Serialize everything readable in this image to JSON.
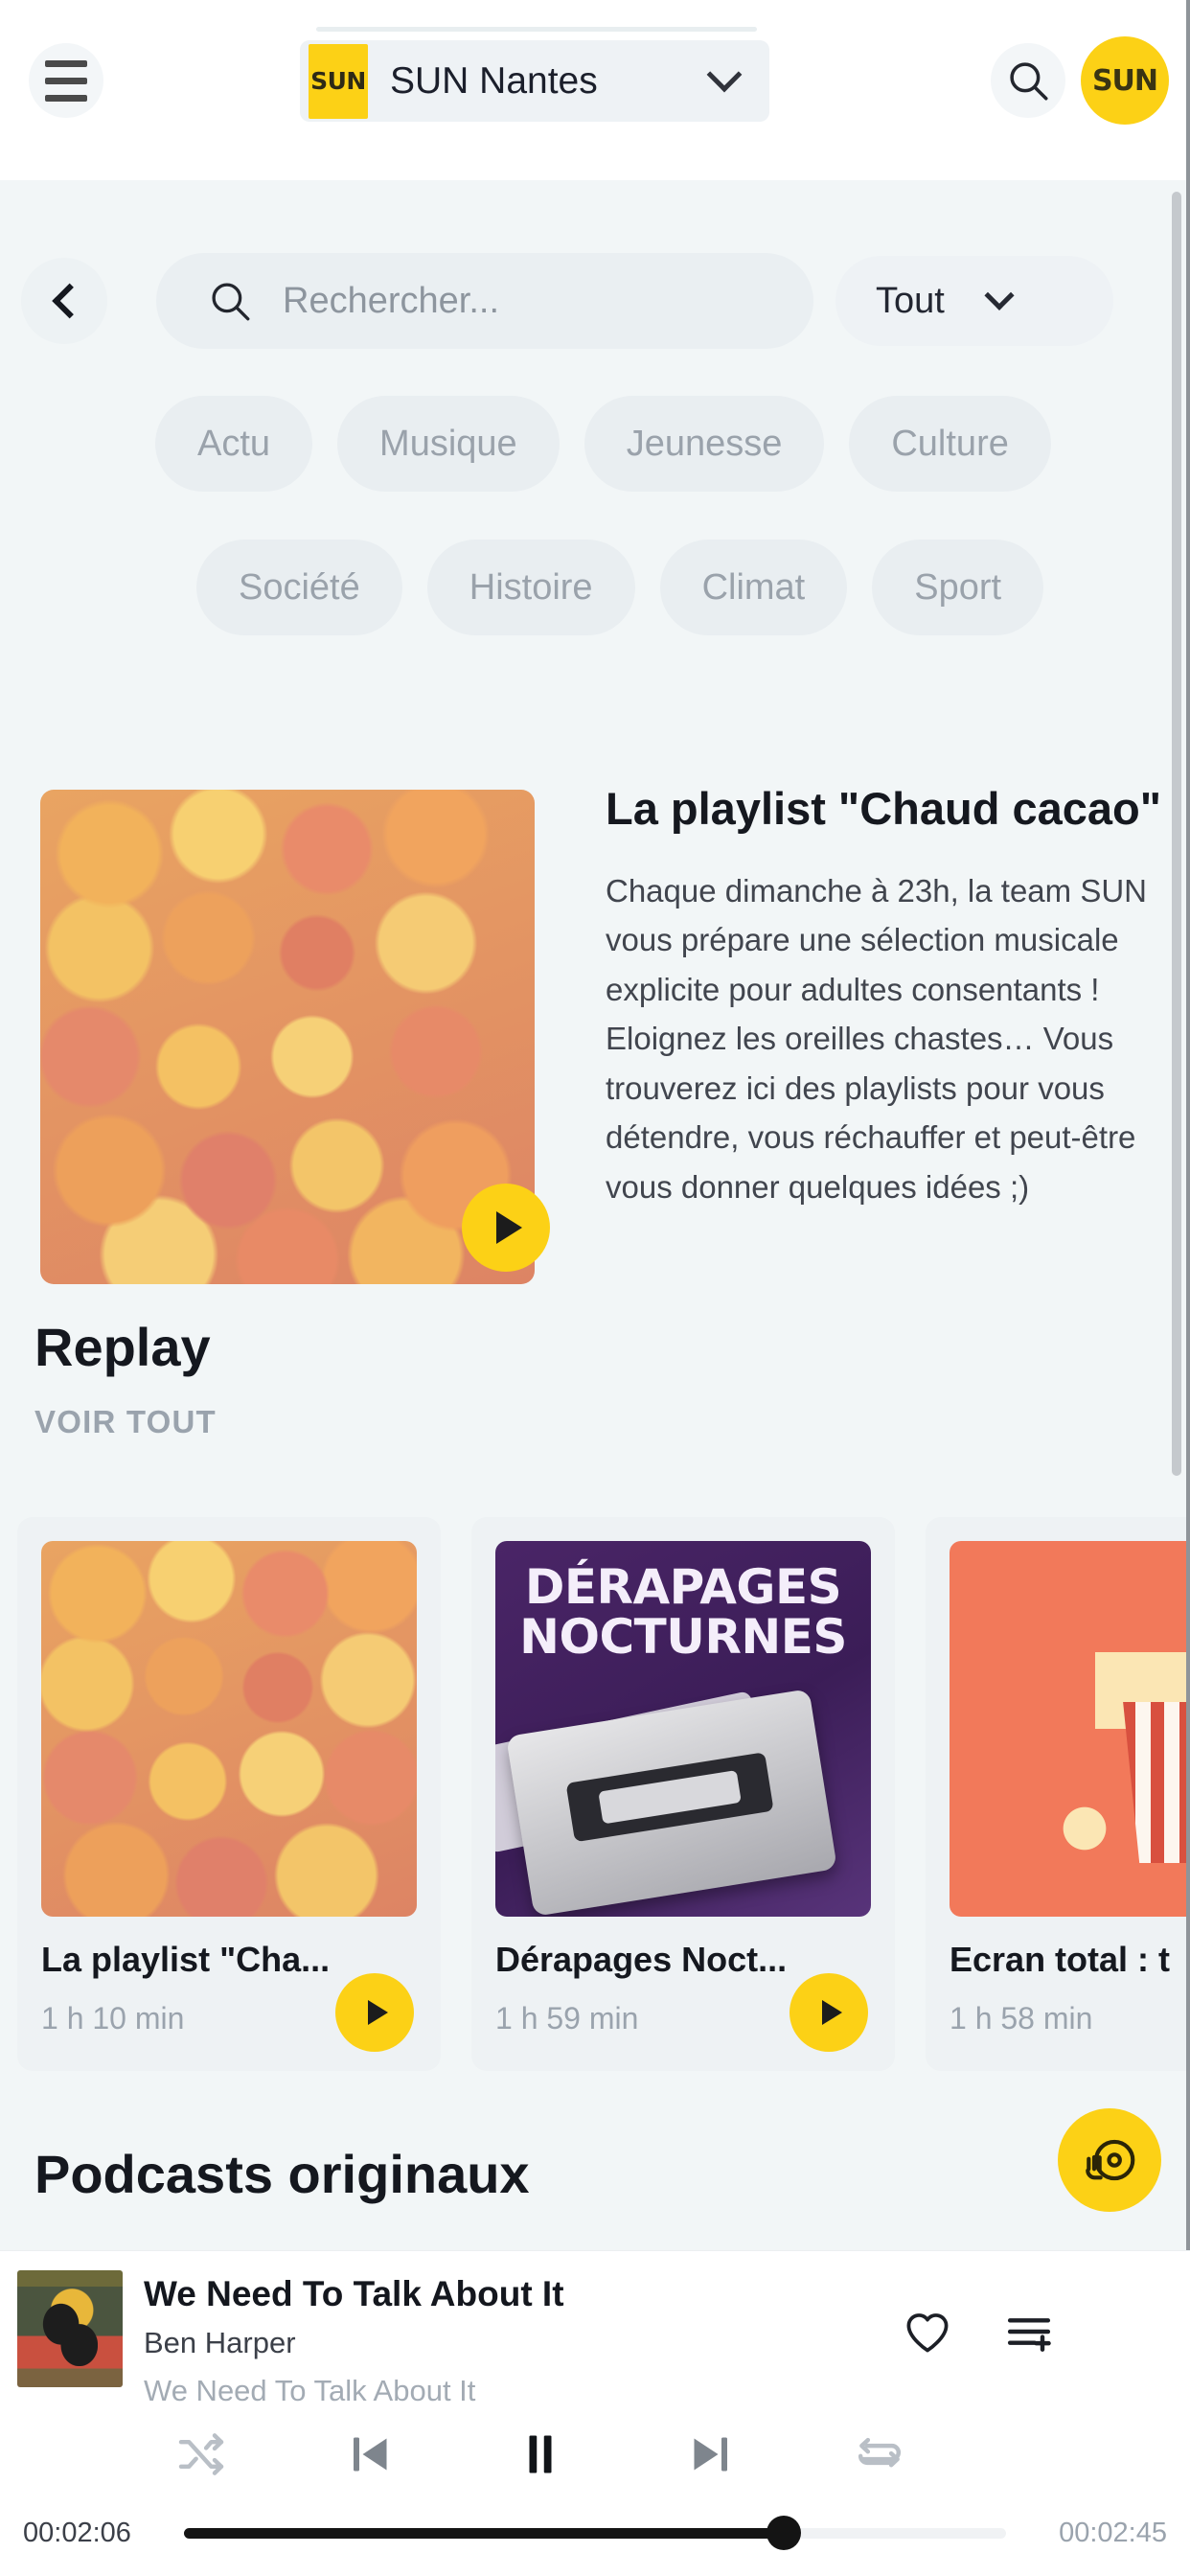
{
  "header": {
    "menu_icon": "hamburger-icon",
    "station": {
      "name": "SUN Nantes",
      "logo_text": "SUN",
      "chevron_icon": "chevron-down-icon"
    },
    "search_icon": "search-icon",
    "avatar": {
      "logo_text": "SUN",
      "icon": "avatar-icon"
    }
  },
  "search": {
    "back_icon": "chevron-left-icon",
    "placeholder": "Rechercher...",
    "icon": "search-icon",
    "scope_label": "Tout",
    "scope_chevron_icon": "chevron-down-icon"
  },
  "filters": {
    "row1": [
      {
        "label": "Actu"
      },
      {
        "label": "Musique"
      },
      {
        "label": "Jeunesse"
      },
      {
        "label": "Culture"
      }
    ],
    "row2": [
      {
        "label": "Société"
      },
      {
        "label": "Histoire"
      },
      {
        "label": "Climat"
      },
      {
        "label": "Sport"
      }
    ]
  },
  "featured": {
    "title": "La playlist \"Chaud cacao\"",
    "description": "Chaque dimanche à 23h, la team SUN vous prépare une sélection musicale explicite pour adultes consentants ! Eloignez les oreilles chastes… Vous trouverez ici des playlists pour vous détendre, vous réchauffer et peut-être vous donner quelques idées ;)",
    "play_icon": "play-icon",
    "image_alt": "apricots-photo"
  },
  "sections": {
    "replay": {
      "title": "Replay",
      "see_all": "VOIR TOUT"
    },
    "podcasts": {
      "title": "Podcasts originaux"
    }
  },
  "replay_cards": [
    {
      "title": "La playlist \"Cha...",
      "duration": "1 h 10 min",
      "artwork": "apricots-photo",
      "play_icon": "play-icon"
    },
    {
      "title": "Dérapages Noct...",
      "duration": "1 h 59 min",
      "artwork": "derapages-nocturnes-cover",
      "artwork_line1": "DÉRAPAGES",
      "artwork_line2": "NOCTURNES",
      "play_icon": "play-icon"
    },
    {
      "title": "Ecran total : t",
      "duration": "1 h 58 min",
      "artwork": "popcorn-illustration",
      "play_icon": "play-icon"
    }
  ],
  "fab": {
    "icon": "dj-turntable-icon"
  },
  "player": {
    "track_title": "We Need To Talk About It",
    "artist": "Ben Harper",
    "album": "We Need To Talk About It",
    "artwork": "album-cover",
    "like_icon": "heart-icon",
    "queue_icon": "add-to-queue-icon",
    "controls": {
      "shuffle_icon": "shuffle-icon",
      "previous_icon": "skip-previous-icon",
      "playpause_icon": "pause-icon",
      "next_icon": "skip-next-icon",
      "repeat_icon": "repeat-icon"
    },
    "elapsed": "00:02:06",
    "total": "00:02:45",
    "progress_percent": 73
  },
  "colors": {
    "accent_yellow": "#fcd116",
    "page_bg": "#f2f6f7",
    "card_bg": "#eef2f4",
    "text_dark": "#15181f",
    "text_muted": "#9aa3ad"
  }
}
